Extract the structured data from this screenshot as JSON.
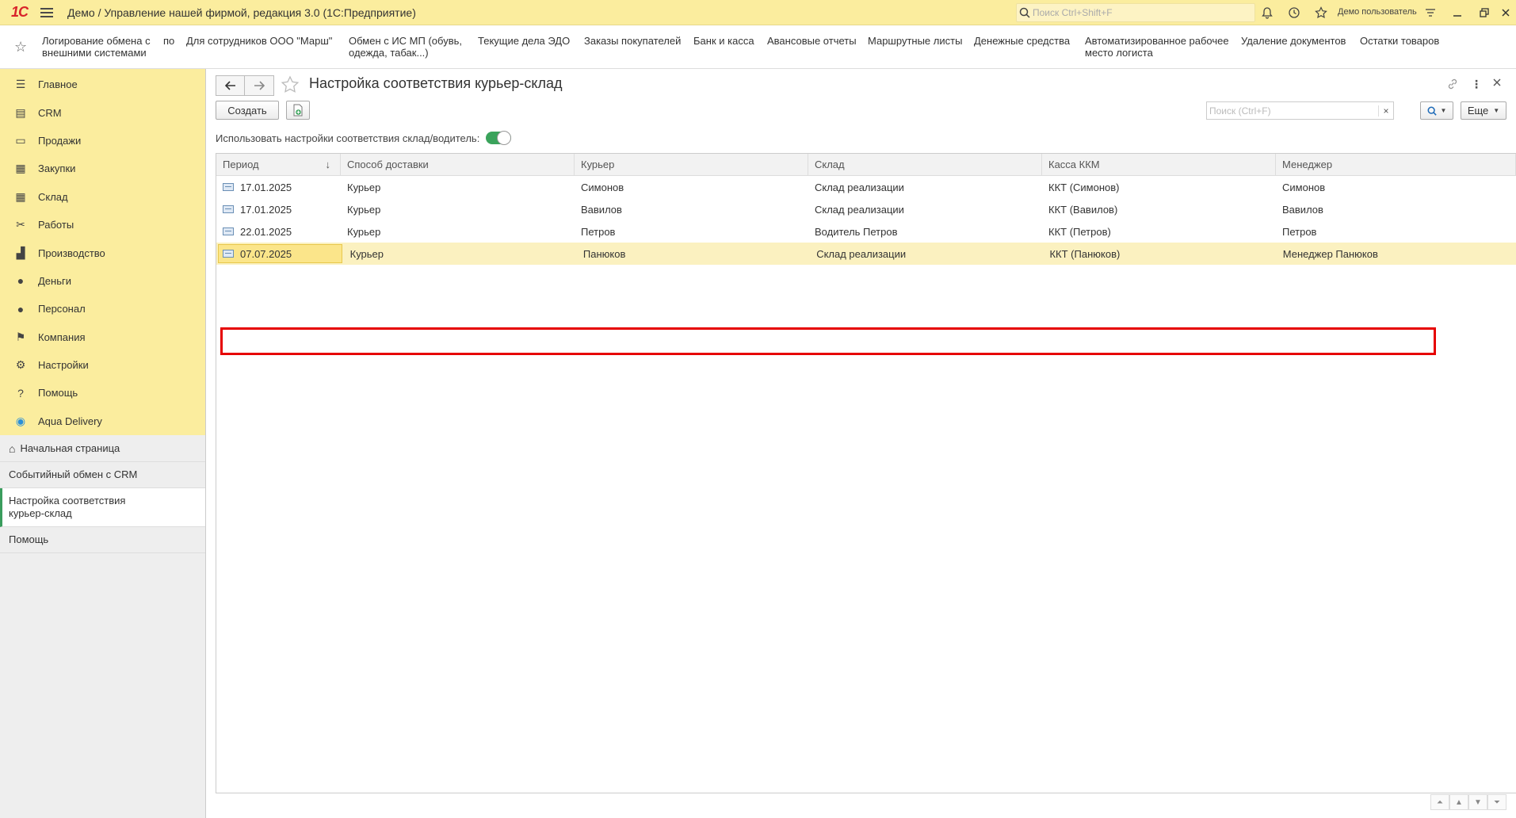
{
  "titlebar": {
    "logo": "1С",
    "title": "Демо / Управление нашей фирмой, редакция 3.0  (1С:Предприятие)",
    "search_placeholder": "Поиск Ctrl+Shift+F",
    "username": "Демо пользователь"
  },
  "favorites": [
    "Логирование обмена с\nвнешними системами",
    "по",
    "Для сотрудников ООО \"Марш\"",
    "Обмен с ИС МП (обувь,\nодежда, табак...)",
    "Текущие дела ЭДО",
    "Заказы покупателей",
    "Банк и касса",
    "Авансовые отчеты",
    "Маршрутные листы",
    "Денежные средства",
    "Автоматизированное рабочее\nместо логиста",
    "Удаление документов",
    "Остатки товаров"
  ],
  "sidebar": {
    "sections": [
      {
        "label": "Главное",
        "icon": "menu-icon"
      },
      {
        "label": "CRM",
        "icon": "crm-icon"
      },
      {
        "label": "Продажи",
        "icon": "cart-icon"
      },
      {
        "label": "Закупки",
        "icon": "purchase-icon"
      },
      {
        "label": "Склад",
        "icon": "warehouse-icon"
      },
      {
        "label": "Работы",
        "icon": "tools-icon"
      },
      {
        "label": "Производство",
        "icon": "factory-icon"
      },
      {
        "label": "Деньги",
        "icon": "money-icon"
      },
      {
        "label": "Персонал",
        "icon": "people-icon"
      },
      {
        "label": "Компания",
        "icon": "flag-icon"
      },
      {
        "label": "Настройки",
        "icon": "gear-icon"
      },
      {
        "label": "Помощь",
        "icon": "help-icon"
      },
      {
        "label": "Aqua Delivery",
        "icon": "location-icon"
      }
    ],
    "nav": [
      {
        "label": "Начальная страница"
      },
      {
        "label": "Событийный обмен с CRM"
      },
      {
        "label": "Настройка соответствия\nкурьер-склад"
      },
      {
        "label": "Помощь"
      }
    ]
  },
  "form": {
    "title": "Настройка соответствия курьер-склад",
    "create_label": "Создать",
    "search_placeholder": "Поиск (Ctrl+F)",
    "more_label": "Еще",
    "toggle_label": "Использовать настройки соответствия склад/водитель:",
    "toggle_on": true
  },
  "table": {
    "columns": [
      "Период",
      "Способ доставки",
      "Курьер",
      "Склад",
      "Касса ККМ",
      "Менеджер"
    ],
    "sort_indicator": "↓",
    "rows": [
      {
        "period": "17.01.2025",
        "delivery": "Курьер",
        "courier": "Симонов",
        "warehouse": "Склад реализации",
        "kkm": "ККТ (Симонов)",
        "manager": "Симонов"
      },
      {
        "period": "17.01.2025",
        "delivery": "Курьер",
        "courier": "Вавилов",
        "warehouse": "Склад реализации",
        "kkm": "ККТ (Вавилов)",
        "manager": "Вавилов"
      },
      {
        "period": "22.01.2025",
        "delivery": "Курьер",
        "courier": "Петров",
        "warehouse": "Водитель Петров",
        "kkm": "ККТ (Петров)",
        "manager": "Петров"
      },
      {
        "period": "07.07.2025",
        "delivery": "Курьер",
        "courier": "Панюков",
        "warehouse": "Склад реализации",
        "kkm": "ККТ (Панюков)",
        "manager": "Менеджер Панюков"
      }
    ],
    "selected_index": 3
  }
}
